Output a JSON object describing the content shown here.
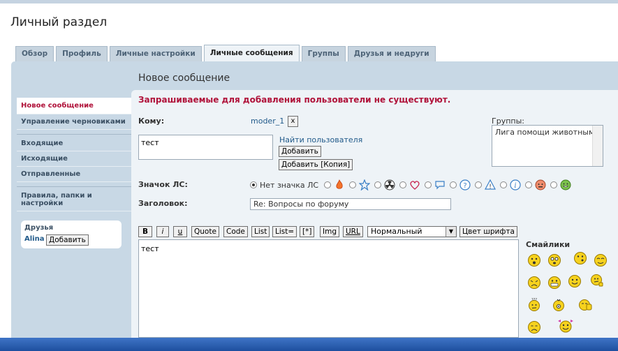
{
  "page": {
    "title": "Личный раздел"
  },
  "tabs": [
    {
      "label": "Обзор",
      "active": false
    },
    {
      "label": "Профиль",
      "active": false
    },
    {
      "label": "Личные настройки",
      "active": false
    },
    {
      "label": "Личные сообщения",
      "active": true
    },
    {
      "label": "Группы",
      "active": false
    },
    {
      "label": "Друзья и недруги",
      "active": false
    }
  ],
  "sidebar": {
    "items": [
      {
        "label": "Новое сообщение"
      },
      {
        "label": "Управление черновиками"
      },
      {
        "label": "Входящие"
      },
      {
        "label": "Исходящие"
      },
      {
        "label": "Отправленные"
      },
      {
        "label": "Правила, папки и настройки"
      }
    ],
    "friends": {
      "title": "Друзья",
      "name": "Alina",
      "add_label": "Добавить"
    }
  },
  "compose": {
    "section_title": "Новое сообщение",
    "error": "Запрашиваемые для добавления пользователи не существуют.",
    "to_label": "Кому:",
    "recipient": "moder_1",
    "remove_label": "x",
    "to_input_value": "тест",
    "find_users_link": "Найти пользователя",
    "add_label": "Добавить",
    "add_copy_label": "Добавить [Копия]",
    "groups_label": "Группы:",
    "groups_option": "Лига помощи животным",
    "icon_label": "Значок ЛС:",
    "no_icon_label": "Нет значка ЛС",
    "subject_label": "Заголовок:",
    "subject_value": "Re: Вопросы по форуму",
    "message_value": "тест"
  },
  "toolbar": {
    "bold": "B",
    "italic": "i",
    "underline": "u",
    "quote": "Quote",
    "code": "Code",
    "list": "List",
    "list_eq": "List=",
    "list_item": "[*]",
    "img": "Img",
    "url": "URL",
    "font_size": "Нормальный",
    "font_color": "Цвет шрифта"
  },
  "smilies": {
    "title": "Смайлики"
  },
  "colors": {
    "error": "#b0123a",
    "link": "#215a8a",
    "frame": "#c8d8e5",
    "panel": "#eef3f7"
  }
}
